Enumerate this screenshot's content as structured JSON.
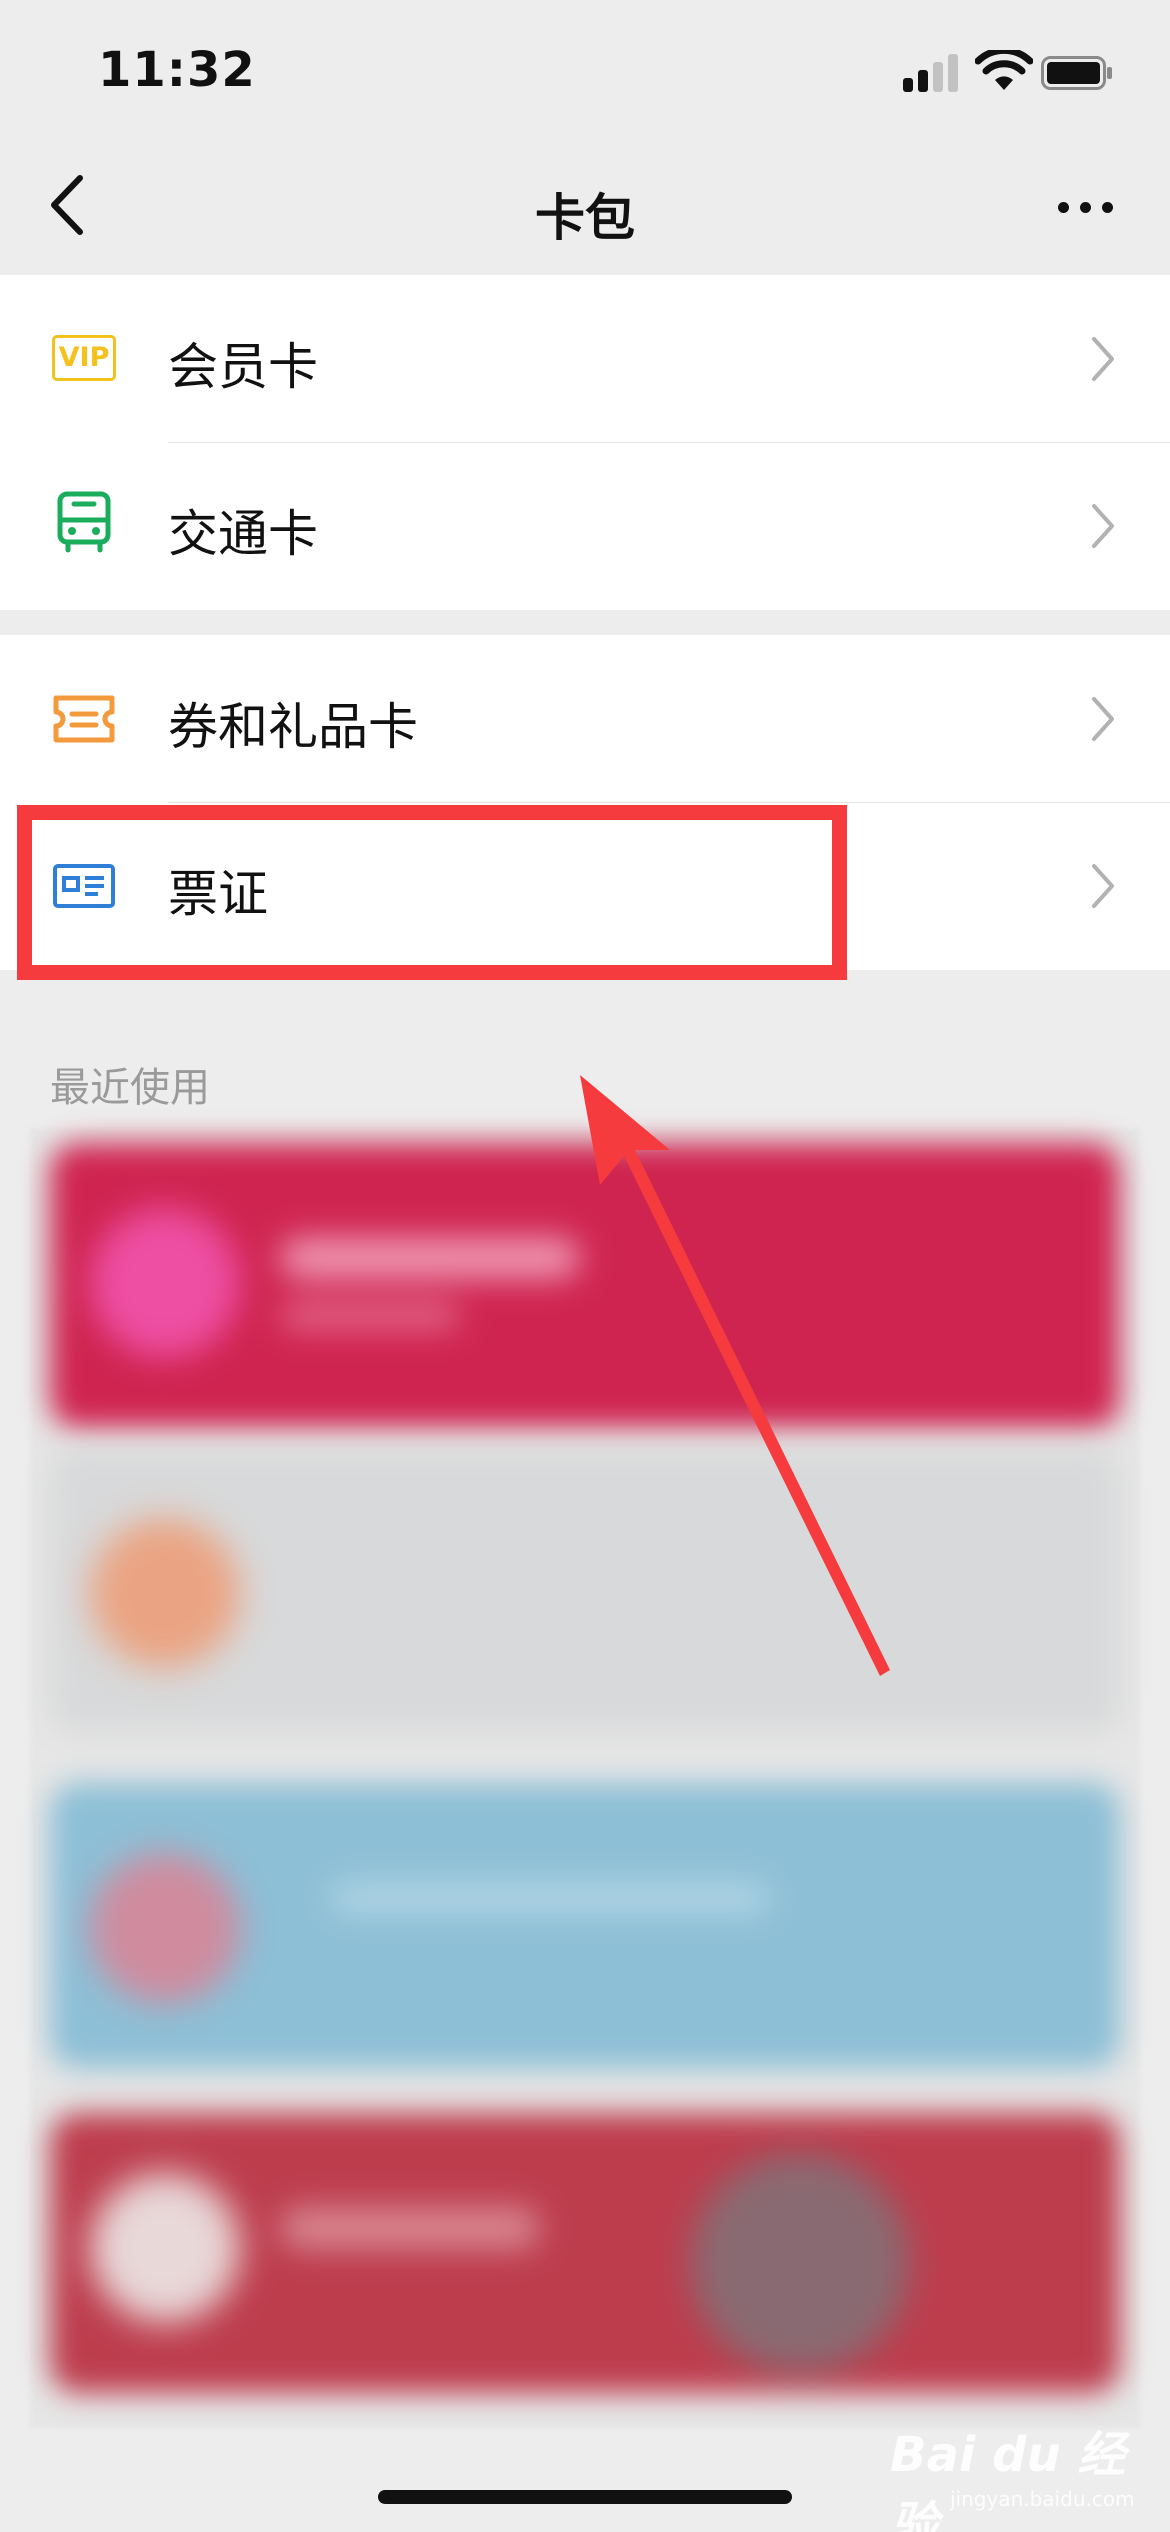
{
  "status_bar": {
    "time": "11:32",
    "signal_icon": "signal-bars-icon",
    "wifi_icon": "wifi-icon",
    "battery_icon": "battery-icon"
  },
  "nav": {
    "back_icon": "chevron-left-icon",
    "title": "卡包",
    "more_icon": "more-dots-icon"
  },
  "menu_groups": [
    {
      "items": [
        {
          "label": "会员卡",
          "icon": "vip-icon",
          "icon_text": "VIP",
          "icon_color": "#f3c21c"
        },
        {
          "label": "交通卡",
          "icon": "bus-icon",
          "icon_color": "#1aad5b"
        }
      ]
    },
    {
      "items": [
        {
          "label": "券和礼品卡",
          "icon": "ticket-icon",
          "icon_color": "#f39a3d"
        },
        {
          "label": "票证",
          "icon": "id-card-icon",
          "icon_color": "#2f7fd8"
        }
      ]
    }
  ],
  "recent": {
    "title": "最近使用"
  },
  "annotation": {
    "highlight_color": "#f53b3e"
  },
  "watermark": {
    "text": "Bai du 经验",
    "sub": "jingyan.baidu.com"
  }
}
